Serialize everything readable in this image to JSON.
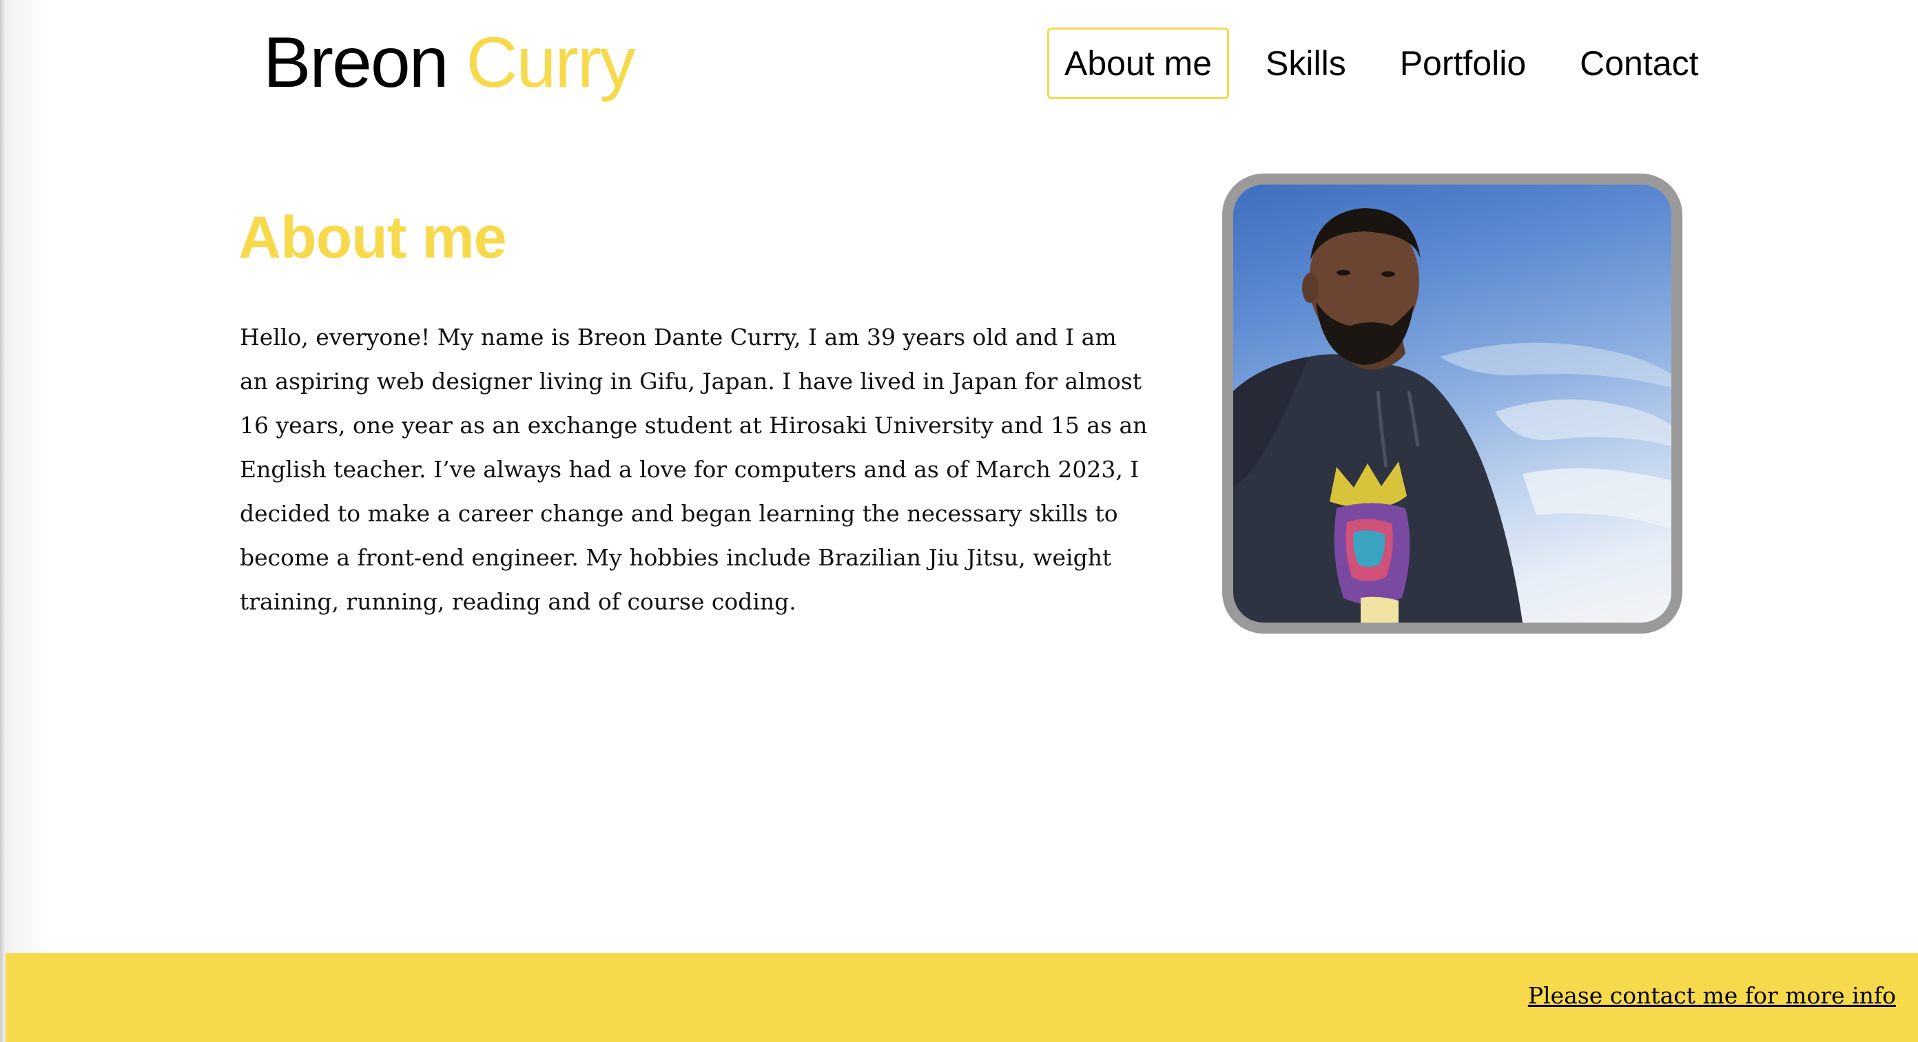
{
  "header": {
    "brand_first": "Breon",
    "brand_last": "Curry",
    "nav": [
      {
        "label": "About me",
        "active": true
      },
      {
        "label": "Skills",
        "active": false
      },
      {
        "label": "Portfolio",
        "active": false
      },
      {
        "label": "Contact",
        "active": false
      }
    ]
  },
  "about": {
    "title": "About me",
    "paragraph": "Hello, everyone! My name is Breon Dante Curry, I am 39 years old and I am an aspiring web designer living in Gifu, Japan. I have lived in Japan for almost 16 years, one year as an exchange student at Hirosaki University and 15 as an English teacher. I’ve always had a love for computers and as of March 2023, I decided to make a career change and began learning the necessary skills to become a front-end engineer. My hobbies include Brazilian Jiu Jitsu, weight training, running, reading and of course coding."
  },
  "footer": {
    "contact_link": "Please contact me for more info"
  },
  "colors": {
    "accent": "#f7d94c",
    "photo_border": "#9a9a9a",
    "text": "#111111"
  }
}
